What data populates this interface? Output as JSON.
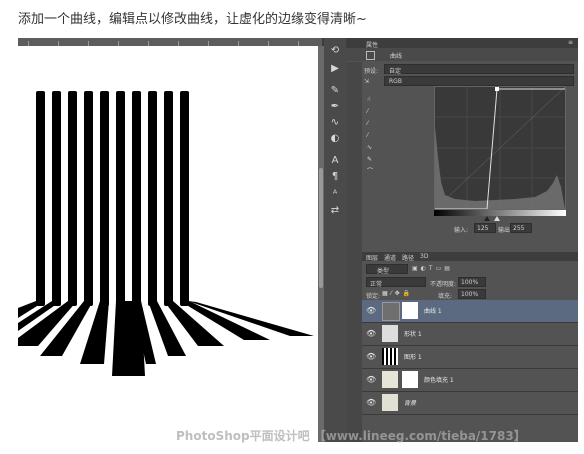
{
  "caption": "添加一个曲线，编辑点以修改曲线，让虚化的边缘变得清晰~",
  "properties": {
    "panel_label": "属性",
    "adjustment_name": "曲线",
    "preset_label": "预设:",
    "preset_value": "自定",
    "channel_value": "RGB",
    "input_label": "输入:",
    "input_value": "125",
    "output_label": "输出:",
    "output_value": "255"
  },
  "layers": {
    "tabs": [
      "图层",
      "通道",
      "路径",
      "3D"
    ],
    "filter_label": "类型",
    "blend_mode": "正常",
    "opacity_label": "不透明度:",
    "opacity_value": "100%",
    "lock_label": "锁定:",
    "fill_label": "填充:",
    "fill_value": "100%",
    "items": [
      {
        "name": "曲线 1",
        "selected": true
      },
      {
        "name": "形状 1",
        "selected": false
      },
      {
        "name": "图形 1",
        "selected": false
      },
      {
        "name": "颜色填充 1",
        "selected": false
      },
      {
        "name": "背景",
        "selected": false
      }
    ]
  },
  "tools": [
    "history-icon",
    "actions-icon",
    "brush-icon",
    "pen-icon",
    "curves-icon",
    "adjust-icon",
    "text-icon",
    "para-icon",
    "character-icon",
    "swap-icon"
  ],
  "watermark": "PhotoShop平面设计吧 【www.lineeg.com/tieba/1783】"
}
